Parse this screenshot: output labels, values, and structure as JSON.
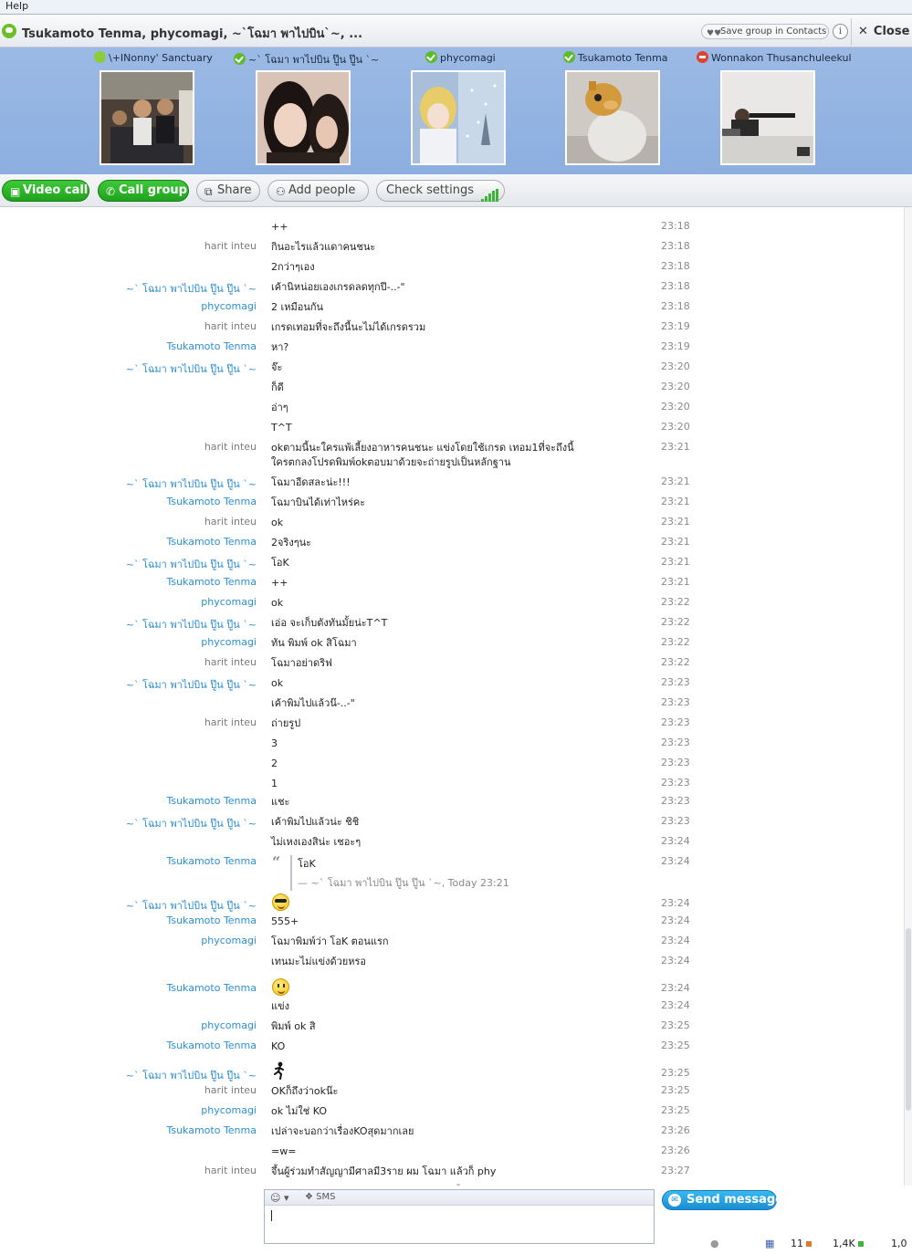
{
  "menu": {
    "help": "Help"
  },
  "window": {
    "title": "Tsukamoto Tenma, phycomagi, ~`โฉมา พาไปบิน`~, ...",
    "save_group": "Save group in Contacts",
    "info": "i",
    "close": "Close"
  },
  "participants": [
    {
      "name": "\\+INonny' Sanctuary",
      "status": "away"
    },
    {
      "name": "~` โฉมา พาไปบิน ปู๊น ปู๊น `~",
      "status": "online"
    },
    {
      "name": "phycomagi",
      "status": "online"
    },
    {
      "name": "Tsukamoto Tenma",
      "status": "online"
    },
    {
      "name": "Wonnakon Thusanchuleekul",
      "status": "dnd"
    }
  ],
  "toolbar": {
    "video_call": "Video call",
    "call_group": "Call group",
    "share": "Share",
    "add_people": "Add people",
    "check_settings": "Check settings"
  },
  "messages": [
    {
      "sender": "",
      "text": "++",
      "time": "23:18"
    },
    {
      "sender": "harit inteu",
      "text": "กินอะไรแล้วแดาคนชนะ",
      "time": "23:18"
    },
    {
      "sender": "",
      "text": "2กว่าๆเอง",
      "time": "23:18"
    },
    {
      "sender": "~` โฉมา พาไปบิน ปู๊น ปู๊น `~",
      "text": "เค้านิหน่อยเองเกรดลดทุกปี-..-\"",
      "time": "23:18"
    },
    {
      "sender": "phycomagi",
      "text": "2 เหมือนกัน",
      "time": "23:18"
    },
    {
      "sender": "harit inteu",
      "text": "เกรดเทอมที่จะถึงนี้นะไม่ได้เกรดรวม",
      "time": "23:19"
    },
    {
      "sender": "Tsukamoto Tenma",
      "text": "หา?",
      "time": "23:19"
    },
    {
      "sender": "~` โฉมา พาไปบิน ปู๊น ปู๊น `~",
      "text": "จ๊ะ",
      "time": "23:20"
    },
    {
      "sender": "",
      "text": "ก็ดี",
      "time": "23:20"
    },
    {
      "sender": "",
      "text": "อ่าๆ",
      "time": "23:20"
    },
    {
      "sender": "",
      "text": "T^T",
      "time": "23:20"
    },
    {
      "sender": "harit inteu",
      "text": "okตามนี้นะใครแพ้เลี้ยงอาหารคนชนะ แข่งโดยใช้เกรด เทอม1ที่จะถึงนี้",
      "text2": "ใครตกลงโปรดพิมพ์okตอบมาด้วยจะถ่ายรูปเป็นหลักฐาน",
      "time": "23:21"
    },
    {
      "sender": "~` โฉมา พาไปบิน ปู๊น ปู๊น `~",
      "text": "โฉมาอีดสละน่ะ!!!",
      "time": "23:21"
    },
    {
      "sender": "Tsukamoto Tenma",
      "text": "โฉมาบินได้เท่าไหร่คะ",
      "time": "23:21"
    },
    {
      "sender": "harit inteu",
      "text": "ok",
      "time": "23:21"
    },
    {
      "sender": "Tsukamoto Tenma",
      "text": "2จริงๆนะ",
      "time": "23:21"
    },
    {
      "sender": "~` โฉมา พาไปบิน ปู๊น ปู๊น `~",
      "text": "โอK",
      "time": "23:21"
    },
    {
      "sender": "Tsukamoto Tenma",
      "text": "++",
      "time": "23:21"
    },
    {
      "sender": "phycomagi",
      "text": "ok",
      "time": "23:22"
    },
    {
      "sender": "~` โฉมา พาไปบิน ปู๊น ปู๊น `~",
      "text": "เอ่อ จะเก็บตังทันมั้ยน่ะT^T",
      "time": "23:22"
    },
    {
      "sender": "phycomagi",
      "text": "ทัน พิมพ์ ok สิโฉมา",
      "time": "23:22"
    },
    {
      "sender": "harit inteu",
      "text": "โฉมาอย่าดริฟ",
      "time": "23:22"
    },
    {
      "sender": "~` โฉมา พาไปบิน ปู๊น ปู๊น `~",
      "text": "ok",
      "time": "23:23"
    },
    {
      "sender": "",
      "text": "เค้าพิมไปแล้วน๊-..-\"",
      "time": "23:23"
    },
    {
      "sender": "harit inteu",
      "text": "ถ่ายรูป",
      "time": "23:23"
    },
    {
      "sender": "",
      "text": "3",
      "time": "23:23"
    },
    {
      "sender": "",
      "text": "2",
      "time": "23:23"
    },
    {
      "sender": "",
      "text": "1",
      "time": "23:23"
    },
    {
      "sender": "Tsukamoto Tenma",
      "text": "แชะ",
      "time": "23:23"
    },
    {
      "sender": "~` โฉมา พาไปบิน ปู๊น ปู๊น `~",
      "text": "เค้าพิมไปแล้วน่ะ ชิชิ",
      "time": "23:23"
    },
    {
      "sender": "",
      "text": "ไม่เหงเองสิน่ะ เชอะๆ",
      "time": "23:24"
    },
    {
      "sender": "Tsukamoto Tenma",
      "quote_text": "โอK",
      "quote_meta": "— ~` โฉมา พาไปบิน ปู๊น ปู๊น `~, Today 23:21",
      "time": "23:24"
    },
    {
      "sender": "~` โฉมา พาไปบิน ปู๊น ปู๊น `~",
      "emoticon": "cool-emoticon",
      "time": "23:24"
    },
    {
      "sender": "Tsukamoto Tenma",
      "text": "555+",
      "time": "23:24"
    },
    {
      "sender": "phycomagi",
      "text": "โฉมาพิมพ์ว่า โอK ตอนแรก",
      "time": "23:24"
    },
    {
      "sender": "",
      "text": "เทนมะไม่แข่งด้วยหรอ",
      "time": "23:24"
    },
    {
      "sender": "Tsukamoto Tenma",
      "emoticon": "smile-emoticon",
      "time": "23:24"
    },
    {
      "sender": "",
      "text": "แข่ง",
      "time": "23:24"
    },
    {
      "sender": "phycomagi",
      "text": "พิมพ์ ok สิ",
      "time": "23:25"
    },
    {
      "sender": "Tsukamoto Tenma",
      "text": "KO",
      "time": "23:25"
    },
    {
      "sender": "~` โฉมา พาไปบิน ปู๊น ปู๊น `~",
      "emoticon": "running-figure-emoticon",
      "time": "23:25"
    },
    {
      "sender": "harit inteu",
      "text": "OKก็ถึงว่าokน๊ะ",
      "time": "23:25"
    },
    {
      "sender": "phycomagi",
      "text": "ok ไม่ใช่ KO",
      "time": "23:25"
    },
    {
      "sender": "Tsukamoto Tenma",
      "text": "เปล่าจะบอกว่าเรื่องKOสุดมากเลย",
      "time": "23:26"
    },
    {
      "sender": "",
      "text": "=w=",
      "time": "23:26"
    },
    {
      "sender": "harit inteu",
      "text": "จึ้นผู้ร่วมทำสัญญามีศาลมี3ราย ผม โฉมา แล้วก็ phy",
      "time": "23:27"
    }
  ],
  "input": {
    "sms_label": "SMS",
    "send": "Send message"
  },
  "status_bar": {
    "contacts": "11",
    "count_a": "1,4K",
    "count_b": "1,0"
  },
  "colors": {
    "sender_blue": "#2b8fd6",
    "sender_grey": "#7b7b7b",
    "accent_green": "#1fa21c",
    "participants_bg": "#9bb9e4"
  }
}
